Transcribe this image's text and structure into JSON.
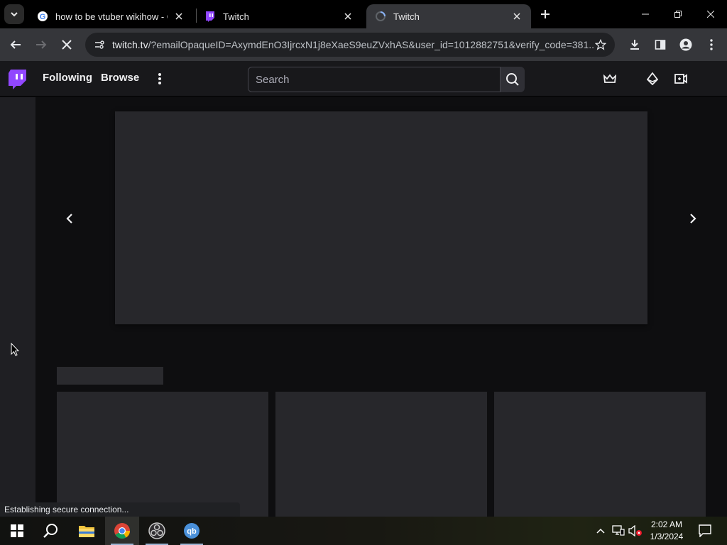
{
  "browser": {
    "tabs": [
      {
        "title": "how to be vtuber wikihow - Go",
        "favicon": "google-icon",
        "active": false
      },
      {
        "title": "Twitch",
        "favicon": "twitch-icon",
        "active": false
      },
      {
        "title": "Twitch",
        "favicon": "loading-icon",
        "active": true
      }
    ],
    "url_host": "twitch.tv",
    "url_rest": "/?emailOpaqueID=AxymdEnO3IjrcxN1j8eXaeS9euZVxhAS&user_id=1012882751&verify_code=381..."
  },
  "twitch": {
    "nav": {
      "following": "Following",
      "browse": "Browse"
    },
    "search": {
      "placeholder": "Search"
    }
  },
  "status": {
    "text": "Establishing secure connection..."
  },
  "taskbar": {
    "apps": [
      "start-icon",
      "search-icon",
      "file-explorer-icon",
      "chrome-icon",
      "obs-icon",
      "qbittorrent-icon"
    ],
    "time": "2:02 AM",
    "date": "1/3/2024"
  },
  "colors": {
    "twitch_purple": "#9147ff",
    "page_bg": "#0e0e10",
    "nav_bg": "#18181b",
    "placeholder": "#27272b"
  }
}
